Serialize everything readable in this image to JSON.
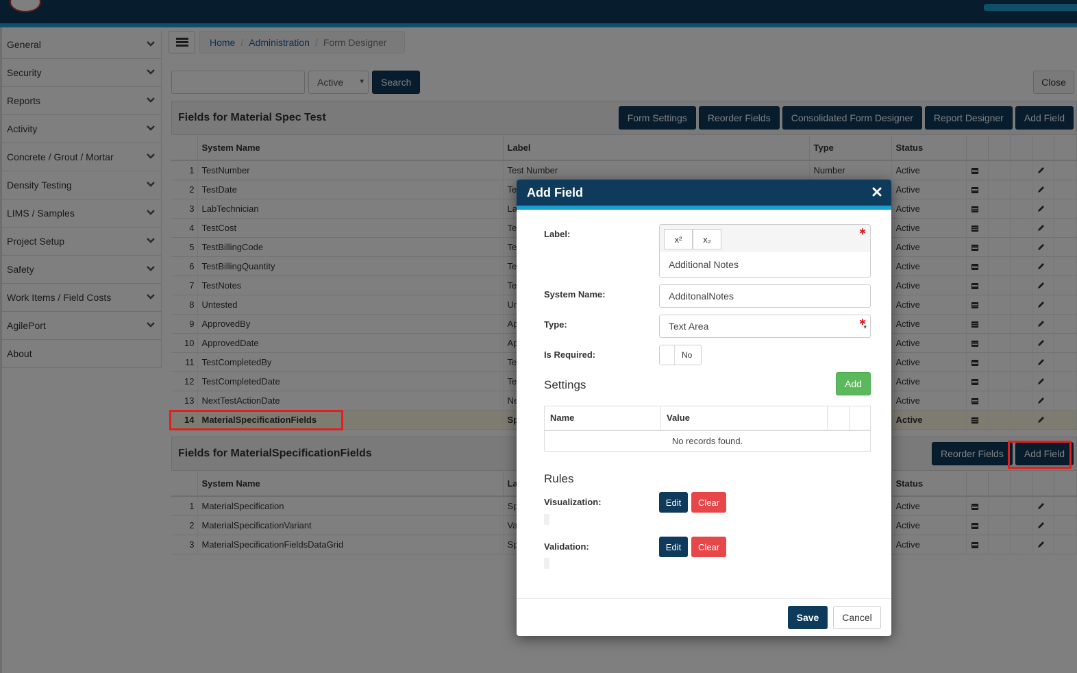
{
  "sidebar": {
    "items": [
      {
        "label": "General"
      },
      {
        "label": "Security"
      },
      {
        "label": "Reports"
      },
      {
        "label": "Activity"
      },
      {
        "label": "Concrete / Grout / Mortar"
      },
      {
        "label": "Density Testing"
      },
      {
        "label": "LIMS / Samples"
      },
      {
        "label": "Project Setup"
      },
      {
        "label": "Safety"
      },
      {
        "label": "Work Items / Field Costs"
      },
      {
        "label": "AgilePort"
      },
      {
        "label": "About"
      }
    ]
  },
  "breadcrumb": {
    "home": "Home",
    "admin": "Administration",
    "current": "Form Designer",
    "sep": "/"
  },
  "search": {
    "status": "Active",
    "button": "Search",
    "close": "Close"
  },
  "panel1": {
    "title": "Fields for Material Spec Test",
    "buttons": [
      "Form Settings",
      "Reorder Fields",
      "Consolidated Form Designer",
      "Report Designer",
      "Add Field"
    ],
    "headers": {
      "system_name": "System Name",
      "label": "Label",
      "type": "Type",
      "status": "Status"
    },
    "rows": [
      {
        "num": "1",
        "name": "TestNumber",
        "label": "Test Number",
        "type": "Number",
        "status": "Active"
      },
      {
        "num": "2",
        "name": "TestDate",
        "label": "Te",
        "type": "",
        "status": "Active"
      },
      {
        "num": "3",
        "name": "LabTechnician",
        "label": "La",
        "type": "",
        "status": "Active"
      },
      {
        "num": "4",
        "name": "TestCost",
        "label": "Te",
        "type": "",
        "status": "Active"
      },
      {
        "num": "5",
        "name": "TestBillingCode",
        "label": "Te",
        "type": "",
        "status": "Active"
      },
      {
        "num": "6",
        "name": "TestBillingQuantity",
        "label": "Te",
        "type": "",
        "status": "Active"
      },
      {
        "num": "7",
        "name": "TestNotes",
        "label": "Te",
        "type": "",
        "status": "Active"
      },
      {
        "num": "8",
        "name": "Untested",
        "label": "Ur",
        "type": "",
        "status": "Active"
      },
      {
        "num": "9",
        "name": "ApprovedBy",
        "label": "Ap",
        "type": "",
        "status": "Active"
      },
      {
        "num": "10",
        "name": "ApprovedDate",
        "label": "Ap",
        "type": "",
        "status": "Active"
      },
      {
        "num": "11",
        "name": "TestCompletedBy",
        "label": "Te",
        "type": "",
        "status": "Active"
      },
      {
        "num": "12",
        "name": "TestCompletedDate",
        "label": "Te",
        "type": "",
        "status": "Active"
      },
      {
        "num": "13",
        "name": "NextTestActionDate",
        "label": "Ne",
        "type": "",
        "status": "Active"
      },
      {
        "num": "14",
        "name": "MaterialSpecificationFields",
        "label": "Sp",
        "type": "",
        "status": "Active"
      }
    ]
  },
  "panel2": {
    "title": "Fields for MaterialSpecificationFields",
    "buttons": [
      "Reorder Fields",
      "Add Field"
    ],
    "headers": {
      "system_name": "System Name",
      "label": "La",
      "status": "Status"
    },
    "rows": [
      {
        "num": "1",
        "name": "MaterialSpecification",
        "label": "Sp",
        "status": "Active"
      },
      {
        "num": "2",
        "name": "MaterialSpecificationVariant",
        "label": "Va",
        "status": "Active"
      },
      {
        "num": "3",
        "name": "MaterialSpecificationFieldsDataGrid",
        "label": "Sp",
        "status": "Active"
      }
    ]
  },
  "modal": {
    "title": "Add Field",
    "label_label": "Label:",
    "label_value": "Additional Notes",
    "superscript": "x²",
    "subscript": "x₂",
    "system_name_label": "System Name:",
    "system_name_value": "AdditonalNotes",
    "type_label": "Type:",
    "type_value": "Text Area",
    "required_label": "Is Required:",
    "required_value": "No",
    "settings_title": "Settings",
    "add_button": "Add",
    "settings_headers": {
      "name": "Name",
      "value": "Value"
    },
    "no_records": "No records found.",
    "rules_title": "Rules",
    "visualization_label": "Visualization:",
    "validation_label": "Validation:",
    "edit": "Edit",
    "clear": "Clear",
    "save": "Save",
    "cancel": "Cancel"
  },
  "colors": {
    "brand": "#0e3a5c",
    "accent": "#1aa0d0",
    "highlight": "#e02020",
    "success": "#5cb85c",
    "danger": "#e8474a"
  }
}
